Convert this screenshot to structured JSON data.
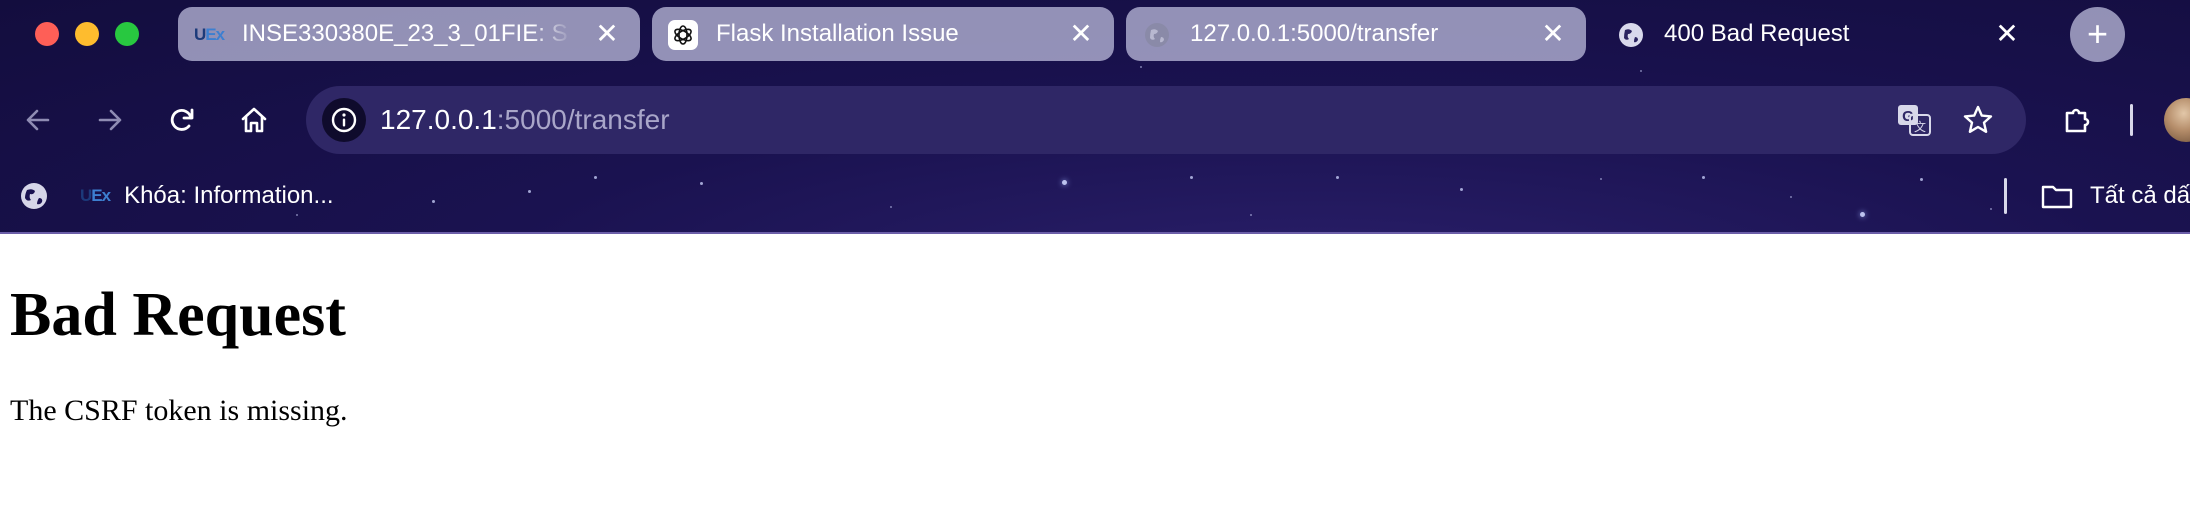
{
  "window": {
    "tabs": [
      {
        "title": "INSE330380E_23_3_01FIE: S",
        "favicon": "uex-logo",
        "close": "✕"
      },
      {
        "title": "Flask Installation Issue",
        "favicon": "openai-icon",
        "close": "✕"
      },
      {
        "title": "127.0.0.1:5000/transfer",
        "favicon": "globe-icon",
        "close": "✕"
      },
      {
        "title": "400 Bad Request",
        "favicon": "globe-icon",
        "close": "✕"
      }
    ],
    "new_tab_label": "+",
    "uex_logo_text": {
      "u": "U",
      "ex": "Ex"
    }
  },
  "toolbar": {
    "address": {
      "host": "127.0.0.1",
      "path": ":5000/transfer"
    },
    "icons": [
      "back-icon",
      "forward-icon",
      "reload-icon",
      "home-icon",
      "site-info-icon",
      "translate-icon",
      "bookmark-star-icon",
      "extensions-icon",
      "profile-avatar"
    ]
  },
  "bookmarks": {
    "items": [
      {
        "label": "Khóa: Information...",
        "icon": "uex-logo"
      }
    ],
    "all_bookmarks_label": "Tất cả dấ"
  },
  "page": {
    "heading": "Bad Request",
    "message": "The CSRF token is missing."
  },
  "colors": {
    "toolbar_bg": "#1a1250",
    "tab_inactive": "#c4c4e2",
    "omnibox": "#2f2766"
  }
}
